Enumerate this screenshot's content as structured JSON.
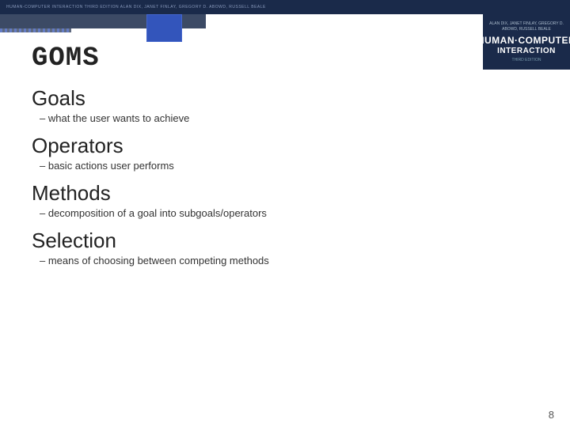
{
  "slide": {
    "title": "GOMS",
    "sections": [
      {
        "heading": "Goals",
        "description": "– what the user wants to achieve"
      },
      {
        "heading": "Operators",
        "description": "– basic actions user performs"
      },
      {
        "heading": "Methods",
        "description": "– decomposition of a goal into subgoals/operators"
      },
      {
        "heading": "Selection",
        "description": "– means of choosing between competing methods"
      }
    ],
    "page_number": "8"
  },
  "book": {
    "authors": "ALAN DIX, JANET FINLAY,\nGREGORY D. ABOWD, RUSSELL BEALE",
    "title_human": "HUMAN·COMPUTER",
    "title_interaction": "INTERACTION",
    "edition": "THIRD EDITION"
  },
  "top_banner": {
    "text": "HUMAN-COMPUTER INTERACTION   THIRD EDITION   ALAN DIX, JANET FINLAY, GREGORY D. ABOWD, RUSSELL BEALE"
  }
}
